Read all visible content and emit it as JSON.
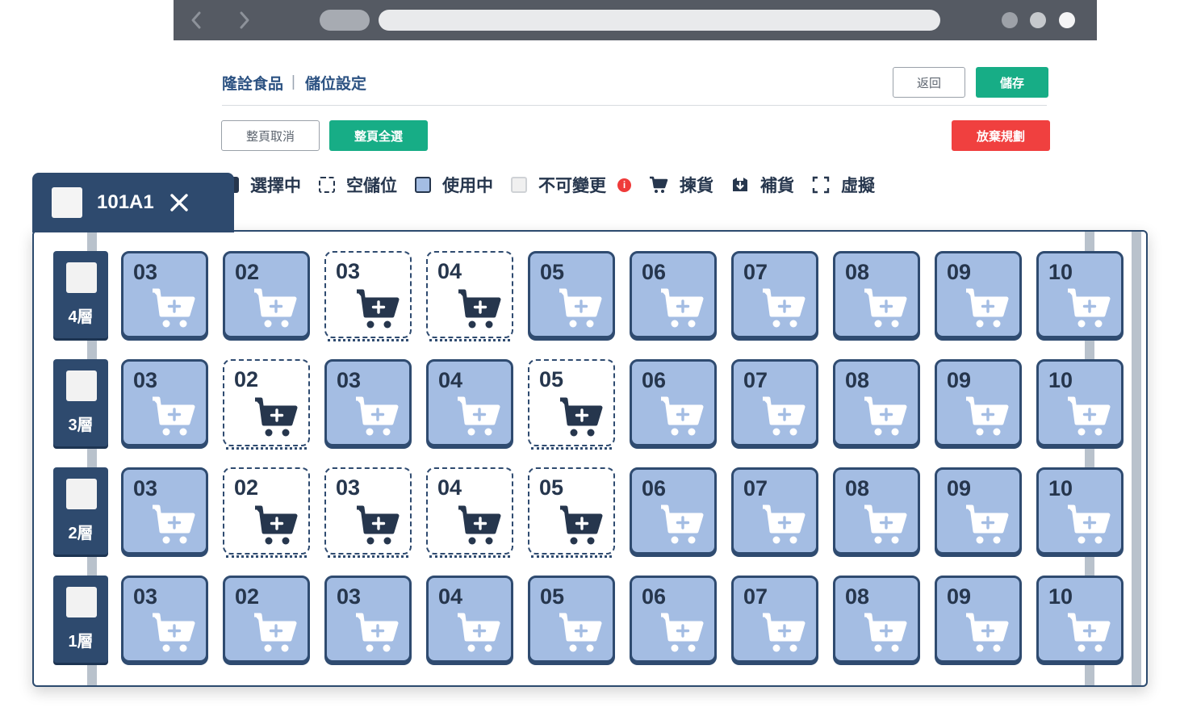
{
  "header": {
    "company": "隆詮食品",
    "page": "儲位設定",
    "back_label": "返回",
    "save_label": "儲存"
  },
  "toolbar": {
    "cancel_page_label": "整頁取消",
    "select_page_label": "整頁全選",
    "discard_label": "放棄規劃"
  },
  "legend": {
    "selecting": "選擇中",
    "empty": "空儲位",
    "in_use": "使用中",
    "locked": "不可變更",
    "pick": "揀貨",
    "replenish": "補貨",
    "virtual": "虛擬"
  },
  "panel": {
    "title": "101A1",
    "levels": [
      {
        "label": "4層",
        "cells": [
          {
            "num": "03",
            "state": "used"
          },
          {
            "num": "02",
            "state": "used"
          },
          {
            "num": "03",
            "state": "empty"
          },
          {
            "num": "04",
            "state": "empty"
          },
          {
            "num": "05",
            "state": "used"
          },
          {
            "num": "06",
            "state": "used"
          },
          {
            "num": "07",
            "state": "used"
          },
          {
            "num": "08",
            "state": "used"
          },
          {
            "num": "09",
            "state": "used"
          },
          {
            "num": "10",
            "state": "used"
          }
        ]
      },
      {
        "label": "3層",
        "cells": [
          {
            "num": "03",
            "state": "used"
          },
          {
            "num": "02",
            "state": "empty"
          },
          {
            "num": "03",
            "state": "used"
          },
          {
            "num": "04",
            "state": "used"
          },
          {
            "num": "05",
            "state": "empty"
          },
          {
            "num": "06",
            "state": "used"
          },
          {
            "num": "07",
            "state": "used"
          },
          {
            "num": "08",
            "state": "used"
          },
          {
            "num": "09",
            "state": "used"
          },
          {
            "num": "10",
            "state": "used"
          }
        ]
      },
      {
        "label": "2層",
        "cells": [
          {
            "num": "03",
            "state": "used"
          },
          {
            "num": "02",
            "state": "empty"
          },
          {
            "num": "03",
            "state": "empty"
          },
          {
            "num": "04",
            "state": "empty"
          },
          {
            "num": "05",
            "state": "empty"
          },
          {
            "num": "06",
            "state": "used"
          },
          {
            "num": "07",
            "state": "used"
          },
          {
            "num": "08",
            "state": "used"
          },
          {
            "num": "09",
            "state": "used"
          },
          {
            "num": "10",
            "state": "used"
          }
        ]
      },
      {
        "label": "1層",
        "cells": [
          {
            "num": "03",
            "state": "used"
          },
          {
            "num": "02",
            "state": "used"
          },
          {
            "num": "03",
            "state": "used"
          },
          {
            "num": "04",
            "state": "used"
          },
          {
            "num": "05",
            "state": "used"
          },
          {
            "num": "06",
            "state": "used"
          },
          {
            "num": "07",
            "state": "used"
          },
          {
            "num": "08",
            "state": "used"
          },
          {
            "num": "09",
            "state": "used"
          },
          {
            "num": "10",
            "state": "used"
          }
        ]
      }
    ]
  },
  "colors": {
    "navy": "#2e4a6e",
    "cell_used": "#a4bde3",
    "green": "#17ad86",
    "red": "#f0403f"
  }
}
